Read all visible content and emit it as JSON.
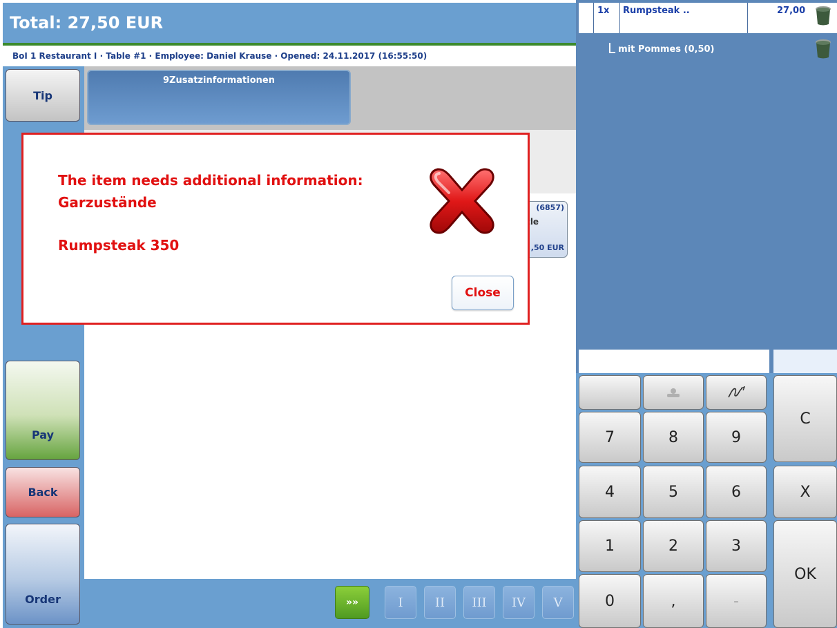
{
  "header": {
    "total": "Total: 27,50 EUR"
  },
  "info_bar": {
    "text": "BoI 1 Restaurant I · Table #1 · Employee: Daniel Krause · Opened: 24.11.2017 (16:55:50)"
  },
  "side_buttons": {
    "tip": "Tip",
    "pay": "Pay",
    "back": "Back",
    "order": "Order"
  },
  "category": {
    "label": "9Zusatzinformationen"
  },
  "product_tile": {
    "number": "(6857)",
    "name_partial": "ätzle",
    "price_partial": ",50 EUR"
  },
  "bottom_bar": {
    "next": "»»",
    "courses": [
      "I",
      "II",
      "III",
      "IV",
      "V"
    ]
  },
  "order_list": {
    "item": {
      "qty": "1x",
      "name": "Rumpsteak ..",
      "price": "27,00"
    },
    "modifier": "mit Pommes (0,50)"
  },
  "numpad": {
    "keys": [
      "7",
      "8",
      "9",
      "4",
      "5",
      "6",
      "1",
      "2",
      "3",
      "0",
      ",",
      "-"
    ],
    "side_keys": {
      "clear": "C",
      "multiply": "X",
      "ok": "OK"
    }
  },
  "dialog": {
    "line1": "The item needs additional information:",
    "line2": "Garzustände",
    "line3": "Rumpsteak 350",
    "close_label": "Close"
  },
  "colors": {
    "accent_blue": "#6a9fd0",
    "panel_blue": "#5c87b8",
    "error_red": "#e02020",
    "pay_green": "#66a43f",
    "back_red": "#d86464"
  }
}
